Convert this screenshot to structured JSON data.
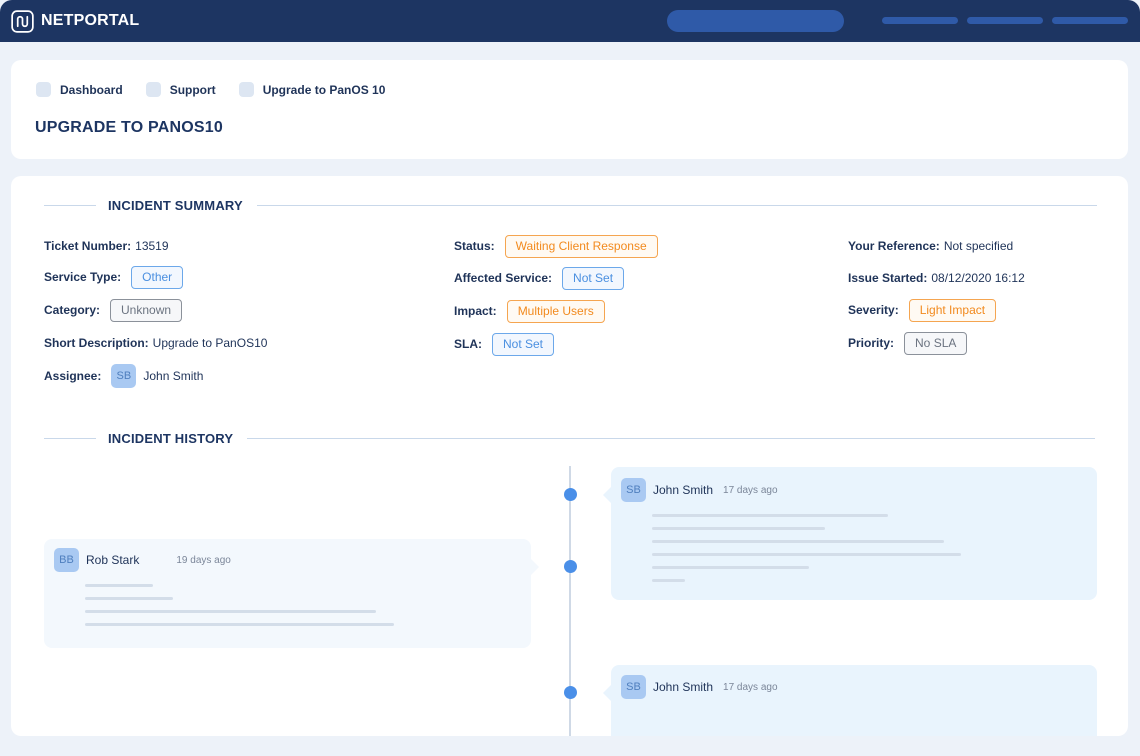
{
  "app": {
    "name": "NETPORTAL",
    "logo_icon": "netportal-logo-icon"
  },
  "breadcrumb": [
    {
      "label": "Dashboard"
    },
    {
      "label": "Support"
    },
    {
      "label": "Upgrade to PanOS 10"
    }
  ],
  "page_title": "UPGRADE TO PANOS10",
  "incident_summary": {
    "heading": "INCIDENT SUMMARY",
    "ticket_number": {
      "label": "Ticket Number:",
      "value": "13519"
    },
    "service_type": {
      "label": "Service Type:",
      "value": "Other"
    },
    "category": {
      "label": "Category:",
      "value": "Unknown"
    },
    "short_description": {
      "label": "Short Description:",
      "value": "Upgrade to PanOS10"
    },
    "assignee": {
      "label": "Assignee:",
      "initials": "SB",
      "name": "John Smith"
    },
    "status": {
      "label": "Status:",
      "value": "Waiting Client Response"
    },
    "affected_service": {
      "label": "Affected Service:",
      "value": "Not Set"
    },
    "impact": {
      "label": "Impact:",
      "value": "Multiple Users"
    },
    "sla": {
      "label": "SLA:",
      "value": "Not Set"
    },
    "your_reference": {
      "label": "Your Reference:",
      "value": "Not specified"
    },
    "issue_started": {
      "label": "Issue Started:",
      "value": "08/12/2020 16:12"
    },
    "severity": {
      "label": "Severity:",
      "value": "Light Impact"
    },
    "priority": {
      "label": "Priority:",
      "value": "No SLA"
    }
  },
  "incident_history": {
    "heading": "INCIDENT HISTORY",
    "entries": [
      {
        "initials": "SB",
        "author": "John Smith",
        "time": "17 days ago"
      },
      {
        "initials": "BB",
        "author": "Rob Stark",
        "time": "19 days ago"
      },
      {
        "initials": "SB",
        "author": "John Smith",
        "time": "17 days ago"
      }
    ]
  },
  "colors": {
    "navy": "#1d3562",
    "accent_blue": "#4a8fe0",
    "status_orange": "#f28a1e",
    "neutral_gray": "#6b7380",
    "background": "#edf2f9"
  }
}
